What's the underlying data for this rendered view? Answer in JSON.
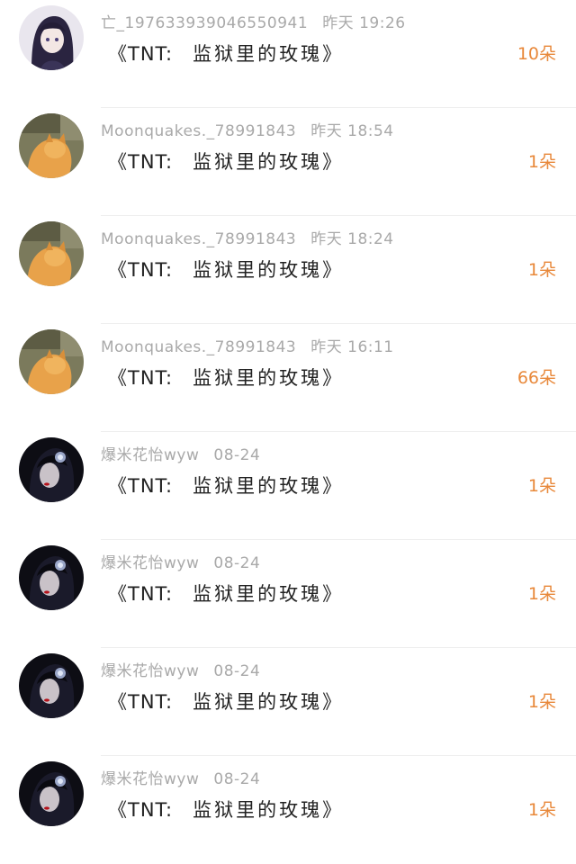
{
  "gifts": [
    {
      "sender": "亡_1976339390465509​41",
      "time": "昨天 19:26",
      "prefix": "《TNT:",
      "name": "监狱里的玫瑰》",
      "count": "10朵",
      "avatar": "anime-girl"
    },
    {
      "sender": "Moonquakes._78991843",
      "time": "昨天 18:54",
      "prefix": "《TNT:",
      "name": "监狱里的玫瑰》",
      "count": "1朵",
      "avatar": "cat-photo"
    },
    {
      "sender": "Moonquakes._78991843",
      "time": "昨天 18:24",
      "prefix": "《TNT:",
      "name": "监狱里的玫瑰》",
      "count": "1朵",
      "avatar": "cat-photo"
    },
    {
      "sender": "Moonquakes._78991843",
      "time": "昨天 16:11",
      "prefix": "《TNT:",
      "name": "监狱里的玫瑰》",
      "count": "66朵",
      "avatar": "cat-photo"
    },
    {
      "sender": "爆米花怡wyw",
      "time": "08-24",
      "prefix": "《TNT:",
      "name": "监狱里的玫瑰》",
      "count": "1朵",
      "avatar": "dark-portrait"
    },
    {
      "sender": "爆米花怡wyw",
      "time": "08-24",
      "prefix": "《TNT:",
      "name": "监狱里的玫瑰》",
      "count": "1朵",
      "avatar": "dark-portrait"
    },
    {
      "sender": "爆米花怡wyw",
      "time": "08-24",
      "prefix": "《TNT:",
      "name": "监狱里的玫瑰》",
      "count": "1朵",
      "avatar": "dark-portrait"
    },
    {
      "sender": "爆米花怡wyw",
      "time": "08-24",
      "prefix": "《TNT:",
      "name": "监狱里的玫瑰》",
      "count": "1朵",
      "avatar": "dark-portrait"
    }
  ],
  "colors": {
    "count": "#e8883a",
    "meta": "#a9a9a9",
    "title": "#222222"
  }
}
